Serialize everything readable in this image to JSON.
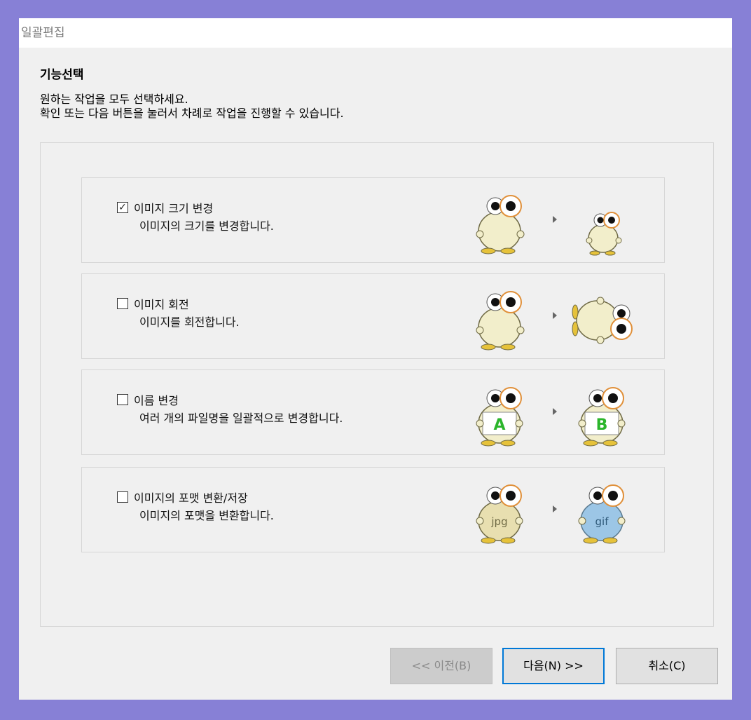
{
  "window": {
    "title": "일괄편집"
  },
  "heading": "기능선택",
  "description": {
    "line1": "원하는 작업을 모두 선택하세요.",
    "line2": "확인 또는 다음 버튼을 눌러서 차례로 작업을 진행할 수 있습니다."
  },
  "options": [
    {
      "title": "이미지 크기 변경",
      "desc": "이미지의 크기를 변경합니다.",
      "checked": true,
      "check_mark": "✓",
      "left_badge": "",
      "right_badge": ""
    },
    {
      "title": "이미지 회전",
      "desc": "이미지를 회전합니다.",
      "checked": false,
      "check_mark": "",
      "left_badge": "",
      "right_badge": ""
    },
    {
      "title": "이름 변경",
      "desc": "여러 개의 파일명을 일괄적으로 변경합니다.",
      "checked": false,
      "check_mark": "",
      "left_badge": "A",
      "right_badge": "B"
    },
    {
      "title": "이미지의 포맷 변환/저장",
      "desc": "이미지의 포맷을 변환합니다.",
      "checked": false,
      "check_mark": "",
      "left_badge": "jpg",
      "right_badge": "gif"
    }
  ],
  "buttons": {
    "prev": "<< 이전(B)",
    "next": "다음(N) >>",
    "cancel": "취소(C)"
  },
  "colors": {
    "background": "#8780d6",
    "accent": "#0078d7",
    "mascot_body": "#f2eecb",
    "mascot_gif": "#9cc6e6"
  }
}
